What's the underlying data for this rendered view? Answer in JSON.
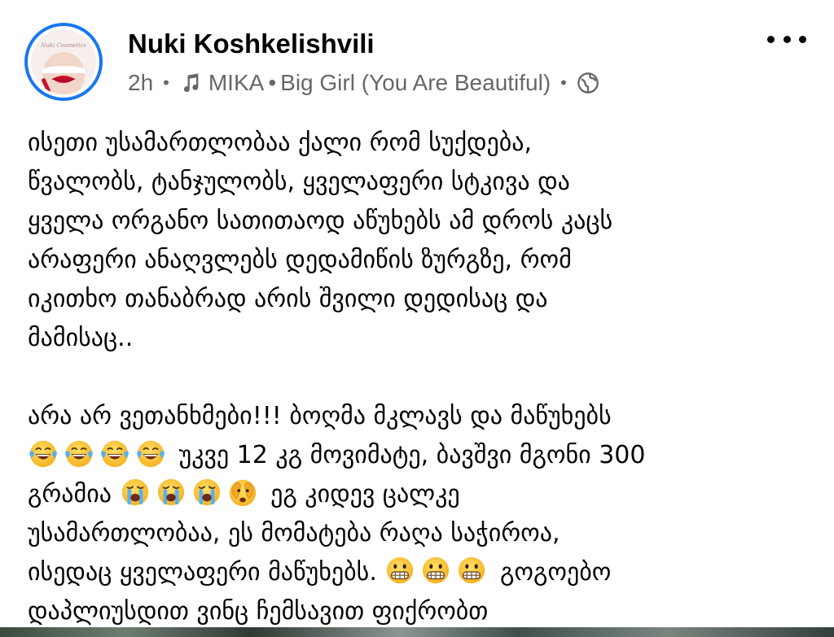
{
  "post": {
    "author": "Nuki Koshkelishvili",
    "avatar_text": "Nuki Cosmetics",
    "time": "2h",
    "music_artist": "MIKA",
    "music_title": "Big Girl (You Are Beautiful)",
    "audience_icon": "globe-icon",
    "more_icon": "more-options-icon"
  },
  "body": {
    "p1": [
      "ისეთი უსამართლობაა ქალი რომ სუქდება,",
      "წვალობს, ტანჯულობს, ყველაფერი სტკივა და",
      "ყველა ორგანო სათითაოდ აწუხებს ამ დროს კაცს",
      "არაფერი ანაღვლებს დედამიწის ზურგზე, რომ",
      "იკითხო თანაბრად არის შვილი დედისაც და",
      "მამისაც.."
    ],
    "p2_line1": "არა არ ვეთანხმები!!! ბოღმა მკლავს და მაწუხებს",
    "p2_line2": "უკვე 12 კგ მოვიმატე, ბავშვი მგონი 300",
    "p2_line3_start": "გრამია",
    "p2_line3_end": "ეგ კიდევ ცალკე",
    "p2_line4": "უსამართლობაა, ეს მომატება რაღა საჭიროა,",
    "p2_line5_start": "ისედაც ყველაფერი მაწუხებს.",
    "p2_line5_end": "გოგოებო",
    "p2_line6": "დაპლიუსდით ვინც ჩემსავით ფიქრობთ"
  },
  "emoji_names": {
    "laugh": "face-with-tears-of-joy-icon",
    "cry": "loudly-crying-face-icon",
    "peek": "face-with-peeking-eye-icon",
    "grimace": "grimacing-face-icon"
  },
  "colors": {
    "avatar_ring": "#1877f2",
    "meta_text": "#65676b",
    "text": "#050505",
    "emoji_yellow": "#ffcc33",
    "tear_blue": "#5ab0f0"
  }
}
